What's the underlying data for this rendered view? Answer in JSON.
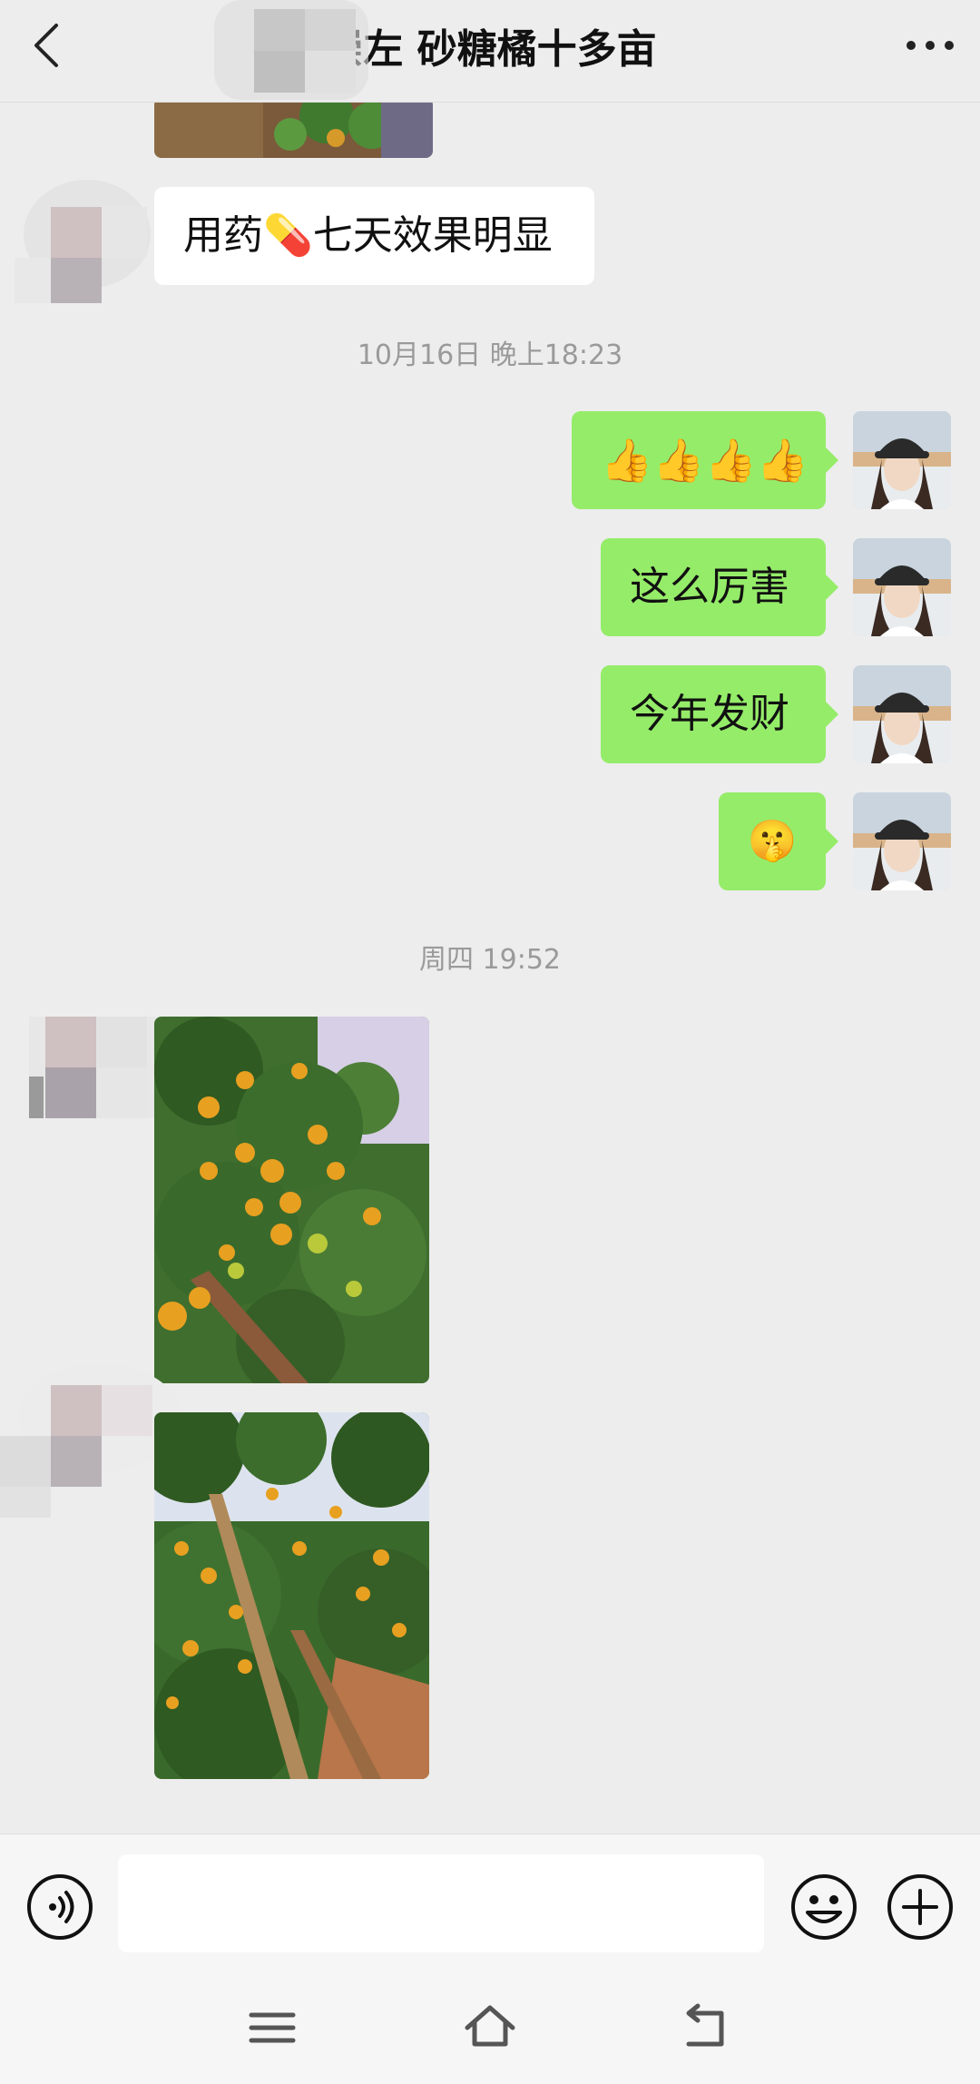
{
  "header": {
    "title": "崇左 砂糖橘十多亩",
    "back_icon": "chevron-left-icon",
    "more_icon": "more-dots-icon"
  },
  "messages": {
    "left_text_1": "用药💊七天效果明显",
    "timestamp_1": "10月16日 晚上18:23",
    "right_text_1": "👍👍👍👍",
    "right_text_2": "这么厉害",
    "right_text_3": "今年发财",
    "right_text_4": "🤫",
    "timestamp_2": "周四 19:52"
  },
  "input_bar": {
    "placeholder": "",
    "voice_icon": "voice-icon",
    "emoji_icon": "emoji-icon",
    "plus_icon": "plus-icon"
  },
  "nav_bar": {
    "menu_icon": "menu-icon",
    "home_icon": "home-icon",
    "back_icon": "back-icon"
  },
  "colors": {
    "background": "#ededed",
    "right_bubble": "#95ec69",
    "left_bubble": "#ffffff",
    "timestamp": "#9a9a9a"
  }
}
